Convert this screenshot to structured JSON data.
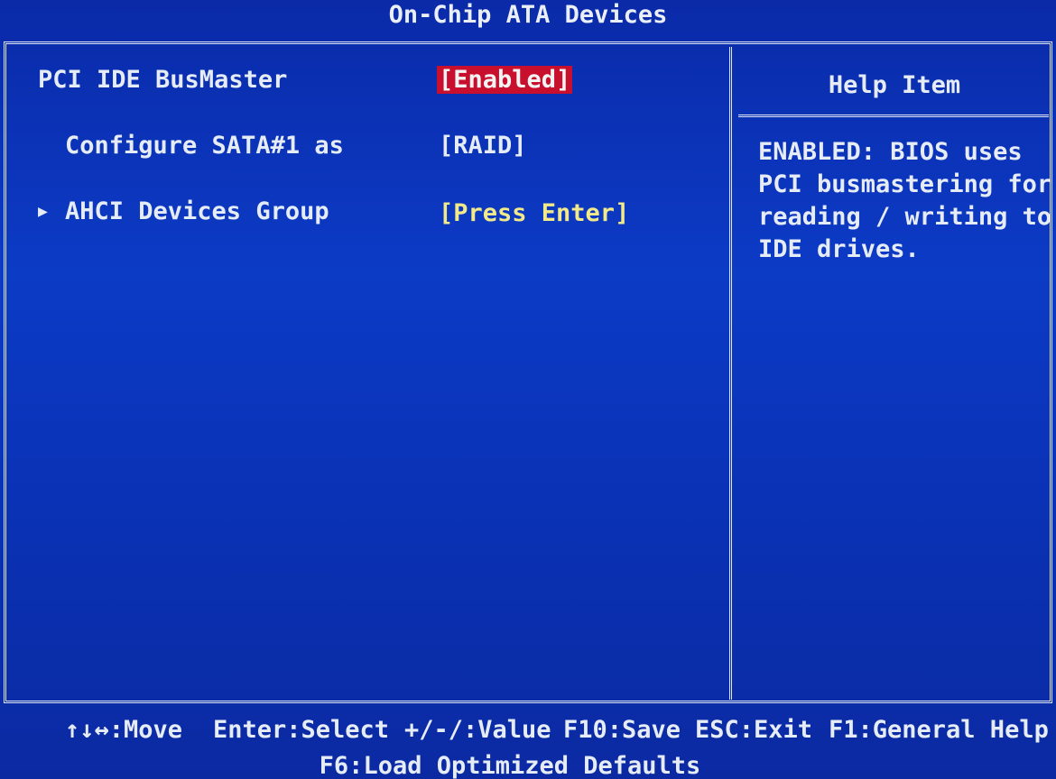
{
  "title": "On-Chip ATA Devices",
  "settings": [
    {
      "label": "PCI IDE BusMaster",
      "value": "[Enabled]"
    },
    {
      "label": "Configure SATA#1 as",
      "value": "[RAID]"
    },
    {
      "label": "AHCI Devices Group",
      "value": "[Press Enter]"
    }
  ],
  "help": {
    "title": "Help Item",
    "lines": [
      "ENABLED: BIOS uses",
      "PCI busmastering for",
      "reading / writing to",
      "IDE drives."
    ]
  },
  "footer": {
    "keys": [
      "↑↓↔:Move",
      "Enter:Select",
      "+/-/:Value",
      "F10:Save",
      "ESC:Exit",
      "F1:General Help"
    ],
    "line2": "F6:Load Optimized Defaults"
  },
  "colors": {
    "background": "#0b2fb0",
    "selected_bg": "#c8102e",
    "submenu_text": "#f2e98a",
    "text": "#e6ecf6"
  },
  "icons": {
    "submenu_marker": "triangle-right-icon"
  }
}
